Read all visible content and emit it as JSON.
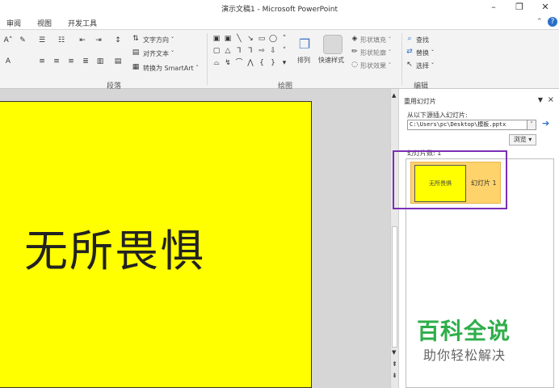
{
  "window": {
    "title": "演示文稿1 - Microsoft PowerPoint",
    "minimize": "–",
    "restore": "❐",
    "close": "✕"
  },
  "tabs": [
    {
      "label": "审阅"
    },
    {
      "label": "视图"
    },
    {
      "label": "开发工具"
    }
  ],
  "ribbon": {
    "paragraph_group": {
      "label": "段落",
      "text_direction": "文字方向 ˇ",
      "align_text": "对齐文本 ˇ",
      "convert_smartart": "转换为 SmartArt ˇ"
    },
    "drawing_group": {
      "label": "绘图",
      "arrange": "排列",
      "quick_styles": "快速样式",
      "shape_fill": "形状填充 ˇ",
      "shape_outline": "形状轮廓 ˇ",
      "shape_effects": "形状效果 ˇ"
    },
    "editing_group": {
      "label": "编辑",
      "find": "查找",
      "replace": "替换 ˇ",
      "select": "选择 ˇ"
    }
  },
  "slide": {
    "main_text": "无所畏惧",
    "background": "#ffff00"
  },
  "reuse_pane": {
    "title": "重用幻灯片",
    "close": "×",
    "insert_from_label": "从以下源插入幻灯片:",
    "path_value": "C:\\Users\\pc\\Desktop\\模板.pptx",
    "browse_label": "浏览 ▾",
    "slide_count": "幻灯片数: 1",
    "slides": [
      {
        "thumb_text": "无所畏惧",
        "label": "幻灯片 1"
      }
    ]
  },
  "watermark": {
    "title": "百科全说",
    "subtitle": "助你轻松解决"
  },
  "colors": {
    "highlight": "#7b2fb7",
    "accent_green": "#2fae4b"
  }
}
